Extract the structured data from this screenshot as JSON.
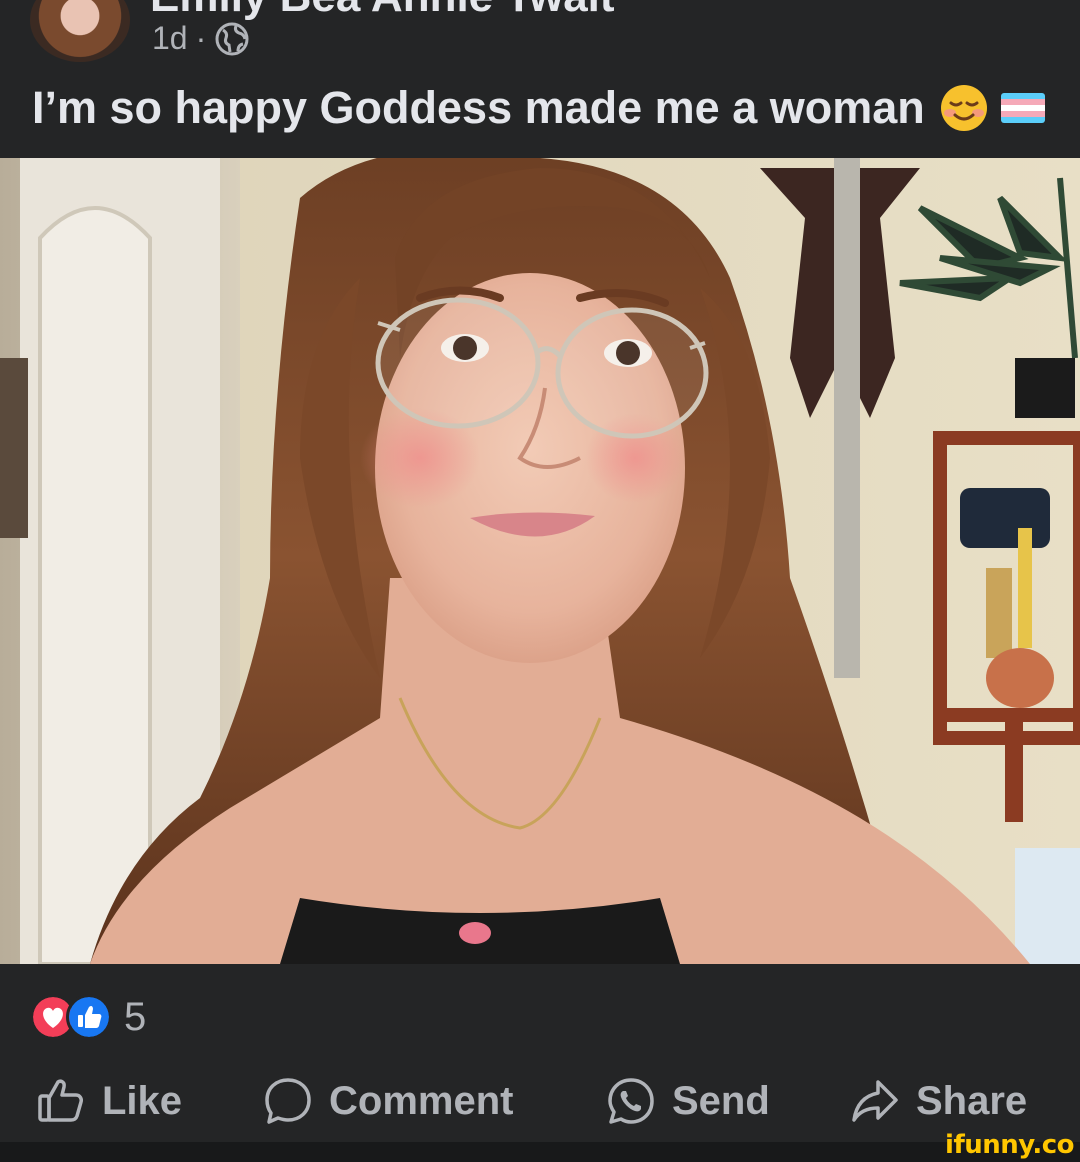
{
  "post": {
    "author_name": "Emily Bea Annie Twait",
    "timestamp": "1d",
    "separator": "·",
    "caption": "I’m so happy Goddess made me a woman"
  },
  "reactions": {
    "count": "5"
  },
  "actions": {
    "like": "Like",
    "comment": "Comment",
    "send": "Send",
    "share": "Share"
  },
  "watermark": "ifunny.co",
  "icons": {
    "close": "close-icon",
    "globe": "globe-icon",
    "smile_emoji": "smiling-face-emoji",
    "flag": "transgender-flag",
    "love": "love-reaction-icon",
    "like_reaction": "like-reaction-icon",
    "like_action": "thumbs-up-icon",
    "comment_action": "speech-bubble-icon",
    "send_action": "whatsapp-icon",
    "share_action": "share-arrow-icon"
  },
  "colors": {
    "background": "#242526",
    "text_primary": "#e4e6eb",
    "text_secondary": "#b0b3b8",
    "love_red": "#f33e58",
    "like_blue": "#1877f2",
    "watermark_yellow": "#ffc600"
  }
}
